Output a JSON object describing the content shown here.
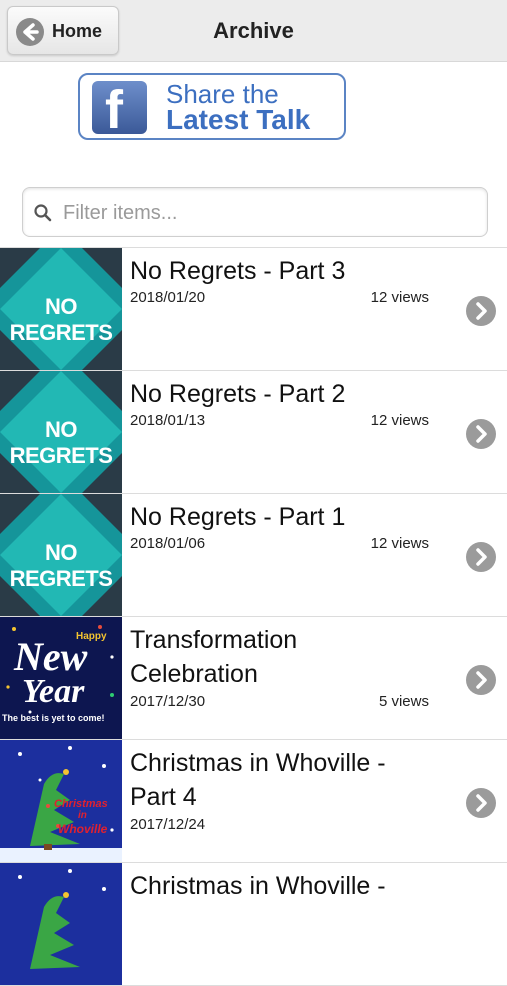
{
  "header": {
    "home_label": "Home",
    "title": "Archive"
  },
  "share_banner": {
    "line1": "Share the",
    "line2": "Latest Talk",
    "logo_letter": "f"
  },
  "filter": {
    "placeholder": "Filter items..."
  },
  "items": [
    {
      "title": "No Regrets - Part 3",
      "date": "2018/01/20",
      "views": "12 views",
      "thumb_text": "NO REGRETS"
    },
    {
      "title": "No Regrets - Part 2",
      "date": "2018/01/13",
      "views": "12 views",
      "thumb_text": "NO REGRETS"
    },
    {
      "title": "No Regrets - Part 1",
      "date": "2018/01/06",
      "views": "12 views",
      "thumb_text": "NO REGRETS"
    },
    {
      "title": "Transformation Celebration",
      "date": "2017/12/30",
      "views": "5 views",
      "thumb_line1": "Happy",
      "thumb_line2": "New",
      "thumb_line3": "Year",
      "thumb_line4": "The best is yet to come!"
    },
    {
      "title": "Christmas in Whoville - Part 4",
      "date": "2017/12/24",
      "views": "",
      "thumb_line1": "Christmas",
      "thumb_line2": "in",
      "thumb_line3": "Whoville"
    },
    {
      "title": "Christmas in Whoville -",
      "date": "",
      "views": ""
    }
  ],
  "colors": {
    "header_bg": "#ececec",
    "facebook_blue": "#3b5998",
    "teal": "#1aa6a6",
    "chevron": "#9b9b9b"
  }
}
